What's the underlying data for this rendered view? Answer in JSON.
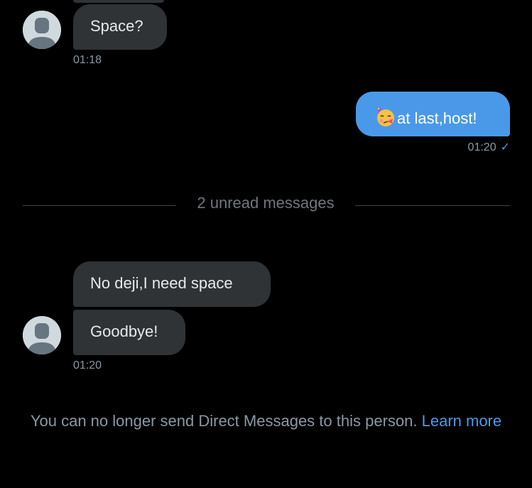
{
  "conversation": {
    "messages": [
      {
        "text": "Space?",
        "direction": "received",
        "time": "01:18"
      },
      {
        "text": "at last,host!",
        "emoji": "partying-face",
        "direction": "sent",
        "time": "01:20"
      },
      {
        "text": "No deji,I need space",
        "direction": "received"
      },
      {
        "text": "Goodbye!",
        "direction": "received",
        "time": "01:20"
      }
    ],
    "unread_divider": "2 unread messages",
    "read_receipt": "✓"
  },
  "footer": {
    "notice_text": "You can no longer send Direct Messages to this person.",
    "learn_more_label": "Learn more"
  },
  "colors": {
    "background": "#000000",
    "received_bubble": "#2f3336",
    "sent_bubble": "#4a99e9",
    "link": "#4a99e9",
    "muted_text": "#8b98a5"
  }
}
